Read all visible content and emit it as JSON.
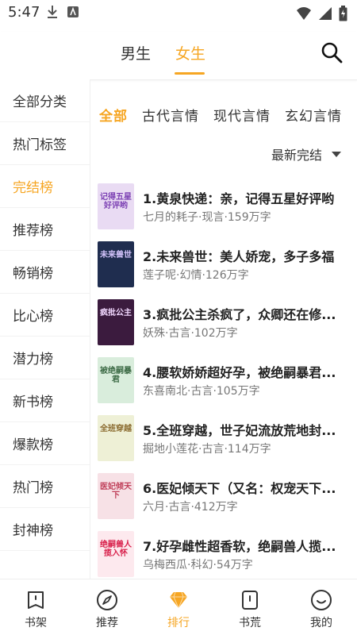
{
  "status": {
    "time": "5:47"
  },
  "top_nav": {
    "tabs": [
      "男生",
      "女生"
    ],
    "active": 1
  },
  "sidebar": {
    "items": [
      "全部分类",
      "热门标签",
      "完结榜",
      "推荐榜",
      "畅销榜",
      "比心榜",
      "潜力榜",
      "新书榜",
      "爆款榜",
      "热门榜",
      "封神榜"
    ],
    "active": 2
  },
  "categories": {
    "items": [
      "全部",
      "古代言情",
      "现代言情",
      "玄幻言情"
    ],
    "active": 0
  },
  "sort": {
    "label": "最新完结"
  },
  "books": [
    {
      "title": "1.黄泉快递：亲，记得五星好评哟",
      "meta": "七月的耗子·现言·159万字",
      "cover_text": "记得五星好评哟",
      "cover_bg": "#e9dbf3",
      "cover_fg": "#7b3fb3"
    },
    {
      "title": "2.未来兽世：美人娇宠，多子多福",
      "meta": "莲子呢·幻情·126万字",
      "cover_text": "未来兽世",
      "cover_bg": "#1f2d4f",
      "cover_fg": "#d7c7ff"
    },
    {
      "title": "3.疯批公主杀疯了，众卿还在修...",
      "meta": "妖殊·古言·102万字",
      "cover_text": "疯批公主",
      "cover_bg": "#3b1b3e",
      "cover_fg": "#f2d8ff"
    },
    {
      "title": "4.腰软娇娇超好孕，被绝嗣暴君...",
      "meta": "东喜南北·古言·105万字",
      "cover_text": "被绝嗣暴君",
      "cover_bg": "#d9eddc",
      "cover_fg": "#3d6b46"
    },
    {
      "title": "5.全班穿越，世子妃流放荒地封...",
      "meta": "掘地小莲花·古言·114万字",
      "cover_text": "全班穿越",
      "cover_bg": "#eef0d6",
      "cover_fg": "#8a6a2f"
    },
    {
      "title": "6.医妃倾天下（又名：权宠天下...",
      "meta": "六月·古言·412万字",
      "cover_text": "医妃倾天下",
      "cover_bg": "#f7e1e6",
      "cover_fg": "#c0405a"
    },
    {
      "title": "7.好孕雌性超香软，绝嗣兽人揽...",
      "meta": "乌梅西瓜·科幻·54万字",
      "cover_text": "绝嗣兽人揽入怀",
      "cover_bg": "#fde9ee",
      "cover_fg": "#d81f4a"
    }
  ],
  "bottom_nav": {
    "items": [
      {
        "label": "书架",
        "icon": "bookshelf-icon"
      },
      {
        "label": "推荐",
        "icon": "compass-icon"
      },
      {
        "label": "排行",
        "icon": "diamond-icon"
      },
      {
        "label": "书荒",
        "icon": "book-alert-icon"
      },
      {
        "label": "我的",
        "icon": "smile-icon"
      }
    ],
    "active": 2
  },
  "colors": {
    "accent": "#f6a623",
    "text": "#222222",
    "meta": "#777777"
  }
}
